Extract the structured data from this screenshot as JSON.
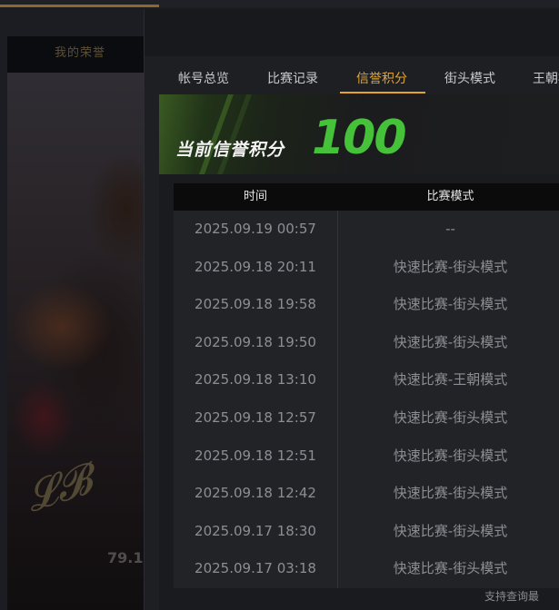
{
  "background": {
    "panel_title": "我的荣誉",
    "jersey_number": "79.1"
  },
  "tabs": [
    {
      "label": "帐号总览",
      "active": false
    },
    {
      "label": "比赛记录",
      "active": false
    },
    {
      "label": "信誉积分",
      "active": true
    },
    {
      "label": "街头模式",
      "active": false
    },
    {
      "label": "王朝模式",
      "active": false
    }
  ],
  "banner": {
    "label": "当前信誉积分",
    "score": "100",
    "score_color": "#46c23a"
  },
  "table": {
    "columns": [
      "时间",
      "比赛模式"
    ],
    "rows": [
      {
        "time": "2025.09.19  00:57",
        "mode": "--"
      },
      {
        "time": "2025.09.18  20:11",
        "mode": "快速比赛-街头模式"
      },
      {
        "time": "2025.09.18  19:58",
        "mode": "快速比赛-街头模式"
      },
      {
        "time": "2025.09.18  19:50",
        "mode": "快速比赛-街头模式"
      },
      {
        "time": "2025.09.18  13:10",
        "mode": "快速比赛-王朝模式"
      },
      {
        "time": "2025.09.18  12:57",
        "mode": "快速比赛-街头模式"
      },
      {
        "time": "2025.09.18  12:51",
        "mode": "快速比赛-街头模式"
      },
      {
        "time": "2025.09.18  12:42",
        "mode": "快速比赛-街头模式"
      },
      {
        "time": "2025.09.17  18:30",
        "mode": "快速比赛-街头模式"
      },
      {
        "time": "2025.09.17  03:18",
        "mode": "快速比赛-街头模式"
      }
    ]
  },
  "footer": {
    "text": "支持查询最"
  },
  "colors": {
    "accent": "#e2a32f",
    "score_green": "#46c23a"
  }
}
